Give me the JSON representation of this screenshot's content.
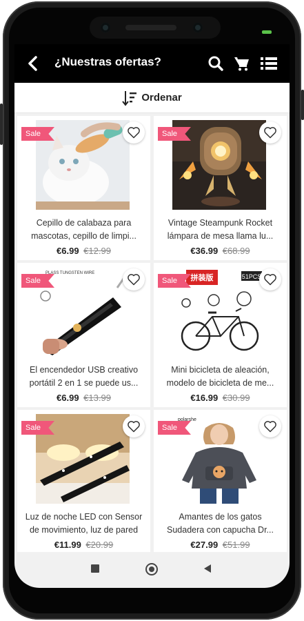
{
  "appbar": {
    "title": "¿Nuestras ofertas?",
    "icons": [
      "back-icon",
      "search-icon",
      "cart-icon",
      "list-icon"
    ]
  },
  "sortbar": {
    "label": "Ordenar",
    "icon": "sort-icon"
  },
  "colors": {
    "sale_badge": "#f0577a",
    "appbar": "#000000",
    "background": "#f1f1f1"
  },
  "products": [
    {
      "badge": "Sale",
      "name_line1": "Cepillo de calabaza para",
      "name_line2": "mascotas, cepillo de limpi...",
      "price": "€6.99",
      "old_price": "€12.99",
      "image": "cat-brush"
    },
    {
      "badge": "Sale",
      "name_line1": "Vintage Steampunk Rocket",
      "name_line2": "lámpara de mesa llama lu...",
      "price": "€36.99",
      "old_price": "€68.99",
      "image": "steampunk-lamp"
    },
    {
      "badge": "Sale",
      "name_line1": "El encendedor USB creativo",
      "name_line2": "portátil 2 en 1 se puede us...",
      "price": "€6.99",
      "old_price": "€13.99",
      "image": "usb-lighter",
      "image_text": "PLASS TUNGSTEN WIRE"
    },
    {
      "badge": "Sale",
      "name_line1": "Mini bicicleta de aleación,",
      "name_line2": "modelo de bicicleta de me...",
      "price": "€16.99",
      "old_price": "€30.99",
      "image": "mini-bicycle",
      "image_text": "拼装版",
      "image_text2": "51PCS"
    },
    {
      "badge": "Sale",
      "name_line1": "Luz de noche LED con Sensor",
      "name_line2": "de movimiento, luz de pared",
      "price": "€11.99",
      "old_price": "€20.99",
      "image": "led-light"
    },
    {
      "badge": "Sale",
      "name_line1": "Amantes de los gatos",
      "name_line2": "Sudadera con capucha Dr...",
      "price": "€27.99",
      "old_price": "€51.99",
      "image": "cat-hoodie",
      "image_text": "polarshe"
    }
  ]
}
